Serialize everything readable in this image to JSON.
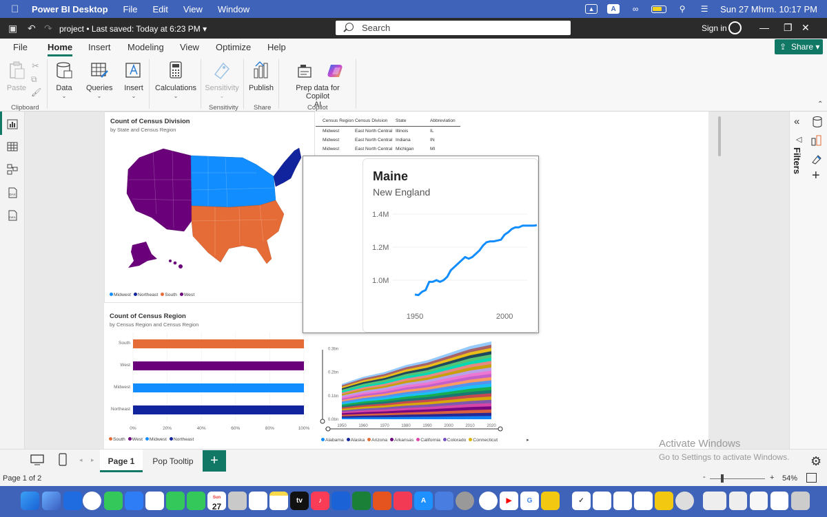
{
  "macbar": {
    "app_name": "Power BI Desktop",
    "menus": [
      "File",
      "Edit",
      "View",
      "Window"
    ],
    "datetime": "Sun 27 Mhrm.  10:17 PM"
  },
  "titlebar": {
    "project": "project",
    "saved": "Last saved: Today at 6:23 PM",
    "search_placeholder": "Search",
    "signin": "Sign in"
  },
  "ribbon_tabs": [
    "File",
    "Home",
    "Insert",
    "Modeling",
    "View",
    "Optimize",
    "Help"
  ],
  "share_label": "Share",
  "ribbon": {
    "paste": "Paste",
    "clipboard": "Clipboard",
    "data": "Data",
    "queries": "Queries",
    "insert": "Insert",
    "calculations": "Calculations",
    "sensitivity": "Sensitivity",
    "sensitivity_group": "Sensitivity",
    "publish": "Publish",
    "share_group": "Share",
    "prep_line1": "Prep data for Copilot",
    "prep_line2": "AI",
    "copilot_group": "Copilot"
  },
  "map_visual": {
    "title": "Count of Census Division",
    "subtitle": "by State and Census Region",
    "legend": [
      {
        "label": "Midwest",
        "color": "#118dff"
      },
      {
        "label": "Northeast",
        "color": "#12239e"
      },
      {
        "label": "South",
        "color": "#e66c37"
      },
      {
        "label": "West",
        "color": "#6b007b"
      }
    ]
  },
  "table_visual": {
    "headers": [
      "Census Region",
      "Census Division",
      "State",
      "Abbreviation"
    ],
    "rows": [
      [
        "Midwest",
        "East North Central",
        "Illinois",
        "IL"
      ],
      [
        "Midwest",
        "East North Central",
        "Indiana",
        "IN"
      ],
      [
        "Midwest",
        "East North Central",
        "Michigan",
        "MI"
      ]
    ]
  },
  "bar_visual": {
    "title": "Count of Census Region",
    "subtitle": "by Census Region and Census Region",
    "legend": [
      {
        "label": "South",
        "color": "#e66c37"
      },
      {
        "label": "West",
        "color": "#6b007b"
      },
      {
        "label": "Midwest",
        "color": "#118dff"
      },
      {
        "label": "Northeast",
        "color": "#12239e"
      }
    ]
  },
  "area_visual": {
    "legend": [
      {
        "label": "Alabama",
        "color": "#118dff"
      },
      {
        "label": "Alaska",
        "color": "#12239e"
      },
      {
        "label": "Arizona",
        "color": "#e66c37"
      },
      {
        "label": "Arkansas",
        "color": "#6b007b"
      },
      {
        "label": "California",
        "color": "#e044a7"
      },
      {
        "label": "Colorado",
        "color": "#744ec2"
      },
      {
        "label": "Connecticut",
        "color": "#d9b300"
      }
    ]
  },
  "tooltip": {
    "title": "Maine",
    "subtitle": "New England"
  },
  "page_tabs": [
    "Page 1",
    "Pop Tooltip"
  ],
  "status": {
    "page": "Page 1 of 2",
    "zoom": "54%"
  },
  "activate": {
    "line1": "Activate Windows",
    "line2": "Go to Settings to activate Windows."
  },
  "filters_label": "Filters",
  "dock": {
    "calendar_month": "Sun",
    "calendar_day": "27",
    "tv_label": "tv"
  },
  "chart_data": [
    {
      "type": "bar",
      "categories": [
        "South",
        "West",
        "Midwest",
        "Northeast"
      ],
      "values": [
        100,
        100,
        100,
        100
      ],
      "xlim": [
        0,
        100
      ],
      "x_ticks": [
        "0%",
        "20%",
        "40%",
        "60%",
        "80%",
        "100%"
      ],
      "colors": [
        "#e66c37",
        "#6b007b",
        "#118dff",
        "#12239e"
      ],
      "title": "Count of Census Region",
      "subtitle": "by Census Region and Census Region"
    },
    {
      "type": "line",
      "title": "Maine",
      "subtitle": "New England",
      "x": [
        1950,
        1952,
        1954,
        1956,
        1958,
        1960,
        1962,
        1964,
        1966,
        1968,
        1970,
        1972,
        1974,
        1976,
        1978,
        1980,
        1982,
        1984,
        1986,
        1988,
        1990,
        1992,
        1994,
        1996,
        1998,
        2000,
        2002,
        2004,
        2006,
        2008,
        2010,
        2012,
        2014,
        2016,
        2018
      ],
      "y": [
        0.913,
        0.91,
        0.93,
        0.94,
        0.99,
        0.99,
        1.0,
        0.99,
        1.0,
        1.02,
        1.06,
        1.08,
        1.1,
        1.12,
        1.14,
        1.13,
        1.14,
        1.16,
        1.18,
        1.21,
        1.23,
        1.235,
        1.235,
        1.24,
        1.245,
        1.275,
        1.29,
        1.31,
        1.32,
        1.32,
        1.33,
        1.33,
        1.33,
        1.33,
        1.333
      ],
      "ylim": [
        0.9,
        1.45
      ],
      "y_ticks": [
        "1.0M",
        "1.2M",
        "1.4M"
      ],
      "x_ticks": [
        "1950",
        "2000"
      ],
      "color": "#118dff"
    },
    {
      "type": "area",
      "x_ticks": [
        "1950",
        "1960",
        "1970",
        "1980",
        "1990",
        "2000",
        "2010",
        "2020"
      ],
      "y_ticks": [
        "0.0bn",
        "0.1bn",
        "0.2bn",
        "0.3bn"
      ],
      "ylim": [
        0,
        0.33
      ],
      "x": [
        1950,
        1960,
        1970,
        1980,
        1990,
        2000,
        2010,
        2020
      ],
      "total": [
        0.15,
        0.18,
        0.2,
        0.23,
        0.25,
        0.28,
        0.31,
        0.33
      ]
    }
  ]
}
